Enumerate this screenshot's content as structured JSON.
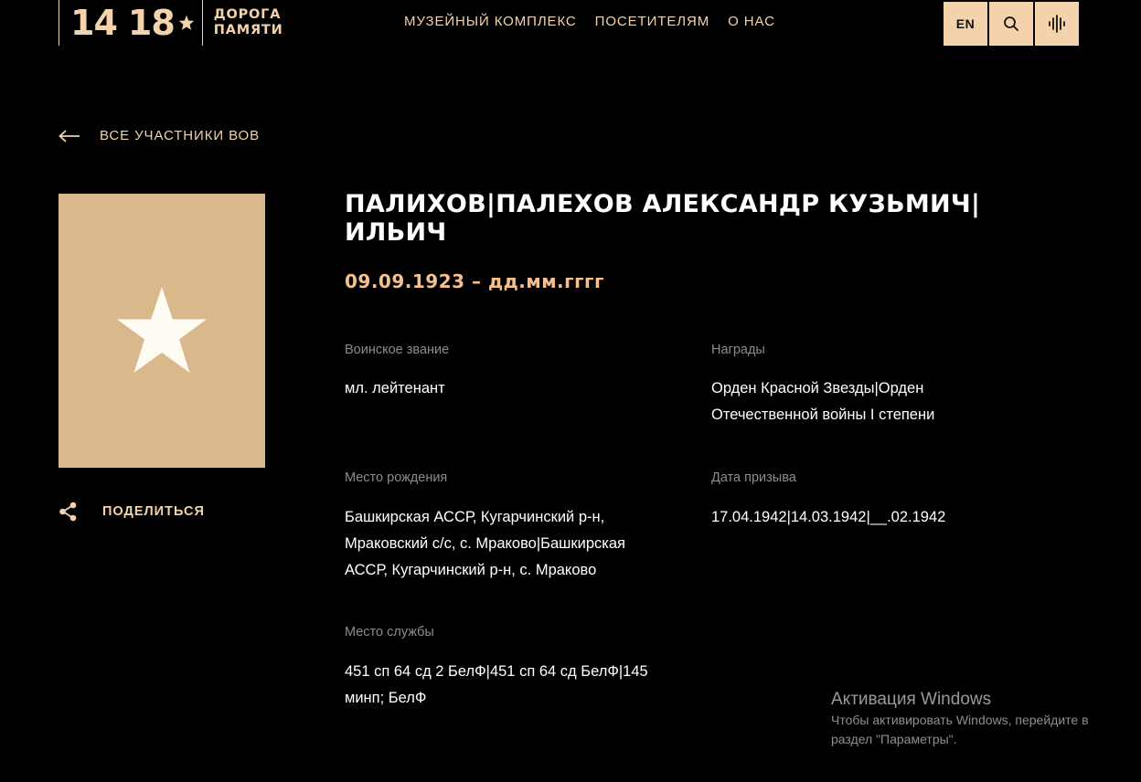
{
  "header": {
    "logo": {
      "num_left": "14",
      "num_right": "18",
      "text_line1": "ДОРОГА",
      "text_line2": "ПАМЯТИ"
    },
    "nav": [
      {
        "label": "МУЗЕЙНЫЙ КОМПЛЕКС"
      },
      {
        "label": "ПОСЕТИТЕЛЯМ"
      },
      {
        "label": "О НАС"
      }
    ],
    "tools": {
      "lang_label": "EN",
      "search_icon": "search-icon",
      "audio_icon": "audio-wave-icon"
    }
  },
  "back": {
    "label": "ВСЕ УЧАСТНИКИ ВОВ",
    "icon": "arrow-left-icon"
  },
  "portrait": {
    "icon": "star-icon"
  },
  "share": {
    "label": "ПОДЕЛИТЬСЯ",
    "icon": "share-icon"
  },
  "person": {
    "name": "ПАЛИХОВ|ПАЛЕХОВ АЛЕКСАНДР КУЗЬМИЧ|ИЛЬИЧ",
    "dates": "09.09.1923 – дд.мм.гггг"
  },
  "fields": {
    "rank": {
      "label": "Воинское звание",
      "value": "мл. лейтенант"
    },
    "awards": {
      "label": "Награды",
      "value": "Орден Красной Звезды|Орден Отечественной войны I степени"
    },
    "birthplace": {
      "label": "Место рождения",
      "value": "Башкирская АССР, Кугарчинский р-н, Мраковский с/с, с. Мраково|Башкирская АССР, Кугарчинский р-н, с. Мраково"
    },
    "draft_date": {
      "label": "Дата призыва",
      "value": "17.04.1942|14.03.1942|__.02.1942"
    },
    "service": {
      "label": "Место службы",
      "value": "451 сп 64 сд 2 БелФ|451 сп 64 сд БелФ|145 минп; БелФ"
    }
  },
  "watermark": {
    "title": "Активация Windows",
    "text": "Чтобы активировать Windows, перейдите в раздел \"Параметры\"."
  },
  "colors": {
    "background": "#000000",
    "accent": "#f3d2ac",
    "card": "#d9b88b",
    "dates": "#f3c08e",
    "label": "#8c8c8c"
  }
}
